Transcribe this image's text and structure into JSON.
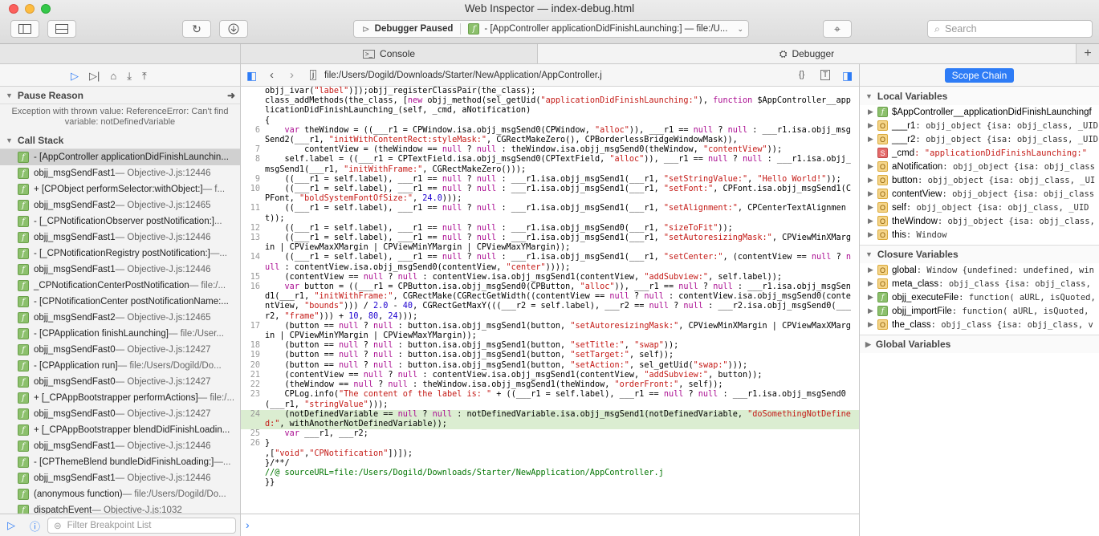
{
  "window": {
    "title": "Web Inspector — index-debug.html"
  },
  "toolbar": {
    "activity_status": "Debugger Paused",
    "activity_frame": "- [AppController applicationDidFinishLaunching:] — file:/U...",
    "search_placeholder": "Search"
  },
  "tabs": [
    {
      "label": "Console",
      "icon": "console-icon"
    },
    {
      "label": "Debugger",
      "icon": "debugger-icon"
    }
  ],
  "editor": {
    "path": "file:/Users/Dogild/Downloads/Starter/NewApplication/AppController.j"
  },
  "pause": {
    "title": "Pause Reason",
    "message": "Exception with thrown value: ReferenceError: Can't find variable: notDefinedVariable"
  },
  "call_stack": {
    "title": "Call Stack",
    "frames": [
      {
        "name": "- [AppController applicationDidFinishLaunchin...",
        "sub": "",
        "selected": true
      },
      {
        "name": "objj_msgSendFast1",
        "sub": " — Objective-J.js:12446"
      },
      {
        "name": "+ [CPObject performSelector:withObject:]",
        "sub": " — f..."
      },
      {
        "name": "objj_msgSendFast2",
        "sub": " — Objective-J.js:12465"
      },
      {
        "name": "- [_CPNotificationObserver postNotification:]",
        "sub": " ..."
      },
      {
        "name": "objj_msgSendFast1",
        "sub": " — Objective-J.js:12446"
      },
      {
        "name": "- [_CPNotificationRegistry postNotification:]",
        "sub": " —..."
      },
      {
        "name": "objj_msgSendFast1",
        "sub": " — Objective-J.js:12446"
      },
      {
        "name": "_CPNotificationCenterPostNotification",
        "sub": " — file:/..."
      },
      {
        "name": "- [CPNotificationCenter postNotificationName:...",
        "sub": ""
      },
      {
        "name": "objj_msgSendFast2",
        "sub": " — Objective-J.js:12465"
      },
      {
        "name": "- [CPApplication finishLaunching]",
        "sub": " — file:/User..."
      },
      {
        "name": "objj_msgSendFast0",
        "sub": " — Objective-J.js:12427"
      },
      {
        "name": "- [CPApplication run]",
        "sub": " — file:/Users/Dogild/Do..."
      },
      {
        "name": "objj_msgSendFast0",
        "sub": " — Objective-J.js:12427"
      },
      {
        "name": "+ [_CPAppBootstrapper performActions]",
        "sub": " — file:/..."
      },
      {
        "name": "objj_msgSendFast0",
        "sub": " — Objective-J.js:12427"
      },
      {
        "name": "+ [_CPAppBootstrapper blendDidFinishLoadin...",
        "sub": ""
      },
      {
        "name": "objj_msgSendFast1",
        "sub": " — Objective-J.js:12446"
      },
      {
        "name": "- [CPThemeBlend bundleDidFinishLoading:]",
        "sub": " —..."
      },
      {
        "name": "objj_msgSendFast1",
        "sub": " — Objective-J.js:12446"
      },
      {
        "name": "(anonymous function)",
        "sub": " — file:/Users/Dogild/Do..."
      },
      {
        "name": "dispatchEvent",
        "sub": " — Objective-J.js:1032"
      }
    ]
  },
  "filter": {
    "placeholder": "Filter Breakpoint List"
  },
  "code_lines": [
    {
      "n": "",
      "t": "objj_ivar(\"label\")]);objj_registerClassPair(the_class);"
    },
    {
      "n": "",
      "t": "class_addMethods(the_class, [new objj_method(sel_getUid(\"applicationDidFinishLaunching:\"), function $AppController__applicationDidFinishLaunching_(self, _cmd, aNotification)"
    },
    {
      "n": "",
      "t": "{"
    },
    {
      "n": "6",
      "t": "    var theWindow = ((___r1 = CPWindow.isa.objj_msgSend0(CPWindow, \"alloc\")), ___r1 == null ? null : ___r1.isa.objj_msgSend2(___r1, \"initWithContentRect:styleMask:\", CGRectMakeZero(), CPBorderlessBridgeWindowMask)),"
    },
    {
      "n": "7",
      "t": "        contentView = (theWindow == null ? null : theWindow.isa.objj_msgSend0(theWindow, \"contentView\"));"
    },
    {
      "n": "8",
      "t": "    self.label = ((___r1 = CPTextField.isa.objj_msgSend0(CPTextField, \"alloc\")), ___r1 == null ? null : ___r1.isa.objj_msgSend1(___r1, \"initWithFrame:\", CGRectMakeZero()));"
    },
    {
      "n": "9",
      "t": "    ((___r1 = self.label), ___r1 == null ? null : ___r1.isa.objj_msgSend1(___r1, \"setStringValue:\", \"Hello World!\"));"
    },
    {
      "n": "10",
      "t": "    ((___r1 = self.label), ___r1 == null ? null : ___r1.isa.objj_msgSend1(___r1, \"setFont:\", CPFont.isa.objj_msgSend1(CPFont, \"boldSystemFontOfSize:\", 24.0)));"
    },
    {
      "n": "11",
      "t": "    ((___r1 = self.label), ___r1 == null ? null : ___r1.isa.objj_msgSend1(___r1, \"setAlignment:\", CPCenterTextAlignment));"
    },
    {
      "n": "12",
      "t": "    ((___r1 = self.label), ___r1 == null ? null : ___r1.isa.objj_msgSend0(___r1, \"sizeToFit\"));"
    },
    {
      "n": "13",
      "t": "    ((___r1 = self.label), ___r1 == null ? null : ___r1.isa.objj_msgSend1(___r1, \"setAutoresizingMask:\", CPViewMinXMargin | CPViewMaxXMargin | CPViewMinYMargin | CPViewMaxYMargin));"
    },
    {
      "n": "14",
      "t": "    ((___r1 = self.label), ___r1 == null ? null : ___r1.isa.objj_msgSend1(___r1, \"setCenter:\", (contentView == null ? null : contentView.isa.objj_msgSend0(contentView, \"center\"))));"
    },
    {
      "n": "15",
      "t": "    (contentView == null ? null : contentView.isa.objj_msgSend1(contentView, \"addSubview:\", self.label));"
    },
    {
      "n": "16",
      "t": "    var button = ((___r1 = CPButton.isa.objj_msgSend0(CPButton, \"alloc\")), ___r1 == null ? null : ___r1.isa.objj_msgSend1(___r1, \"initWithFrame:\", CGRectMake(CGRectGetWidth((contentView == null ? null : contentView.isa.objj_msgSend0(contentView, \"bounds\"))) / 2.0 - 40, CGRectGetMaxY(((___r2 = self.label), ___r2 == null ? null : ___r2.isa.objj_msgSend0(___r2, \"frame\"))) + 10, 80, 24)));"
    },
    {
      "n": "17",
      "t": "    (button == null ? null : button.isa.objj_msgSend1(button, \"setAutoresizingMask:\", CPViewMinXMargin | CPViewMaxXMargin | CPViewMinYMargin | CPViewMaxYMargin));"
    },
    {
      "n": "18",
      "t": "    (button == null ? null : button.isa.objj_msgSend1(button, \"setTitle:\", \"swap\"));"
    },
    {
      "n": "19",
      "t": "    (button == null ? null : button.isa.objj_msgSend1(button, \"setTarget:\", self));"
    },
    {
      "n": "20",
      "t": "    (button == null ? null : button.isa.objj_msgSend1(button, \"setAction:\", sel_getUid(\"swap:\")));"
    },
    {
      "n": "21",
      "t": "    (contentView == null ? null : contentView.isa.objj_msgSend1(contentView, \"addSubview:\", button));"
    },
    {
      "n": "22",
      "t": "    (theWindow == null ? null : theWindow.isa.objj_msgSend1(theWindow, \"orderFront:\", self));"
    },
    {
      "n": "23",
      "t": "    CPLog.info(\"The content of the label is: \" + ((___r1 = self.label), ___r1 == null ? null : ___r1.isa.objj_msgSend0(___r1, \"stringValue\")));"
    },
    {
      "n": "24",
      "t": "    (notDefinedVariable == null ? null : notDefinedVariable.isa.objj_msgSend1(notDefinedVariable, \"doSomethingNotDefined:\", withAnotherNotDefinedVariable));",
      "hl": true
    },
    {
      "n": "25",
      "t": "    var ___r1, ___r2;"
    },
    {
      "n": "26",
      "t": "}"
    },
    {
      "n": "",
      "t": ",[\"void\",\"CPNotification\"])]);"
    },
    {
      "n": "",
      "t": "}/**/"
    },
    {
      "n": "",
      "t": "//@ sourceURL=file:/Users/Dogild/Downloads/Starter/NewApplication/AppController.j"
    },
    {
      "n": "",
      "t": "}}"
    }
  ],
  "sidebar_right": {
    "scope_button": "Scope Chain",
    "local": {
      "title": "Local Variables",
      "vars": [
        {
          "icon": "f",
          "name": "$AppController__applicationDidFinishLaunchingf",
          "val": ""
        },
        {
          "icon": "o",
          "name": "___r1",
          "val": ": objj_object {isa: objj_class, _UID"
        },
        {
          "icon": "o",
          "name": "___r2",
          "val": ": objj_object {isa: objj_class, _UID"
        },
        {
          "icon": "s",
          "name": "_cmd",
          "val": ": \"applicationDidFinishLaunching:\""
        },
        {
          "icon": "o",
          "name": "aNotification",
          "val": ": objj_object {isa: objj_class"
        },
        {
          "icon": "o",
          "name": "button",
          "val": ": objj_object {isa: objj_class, _UI"
        },
        {
          "icon": "o",
          "name": "contentView",
          "val": ": objj_object {isa: objj_class"
        },
        {
          "icon": "o",
          "name": "self",
          "val": ": objj_object {isa: objj_class, _UID"
        },
        {
          "icon": "o",
          "name": "theWindow",
          "val": ": objj_object {isa: objj_class,"
        },
        {
          "icon": "o",
          "name": "this",
          "val": ": Window"
        }
      ]
    },
    "closure": {
      "title": "Closure Variables",
      "vars": [
        {
          "icon": "o",
          "name": "global",
          "val": ": Window {undefined: undefined, win"
        },
        {
          "icon": "o",
          "name": "meta_class",
          "val": ": objj_class {isa: objj_class,"
        },
        {
          "icon": "f",
          "name": "objj_executeFile",
          "val": ": function( aURL, isQuoted,"
        },
        {
          "icon": "f",
          "name": "objj_importFile",
          "val": ": function( aURL, isQuoted,"
        },
        {
          "icon": "o",
          "name": "the_class",
          "val": ": objj_class {isa: objj_class, v"
        }
      ]
    },
    "global": {
      "title": "Global Variables"
    }
  }
}
